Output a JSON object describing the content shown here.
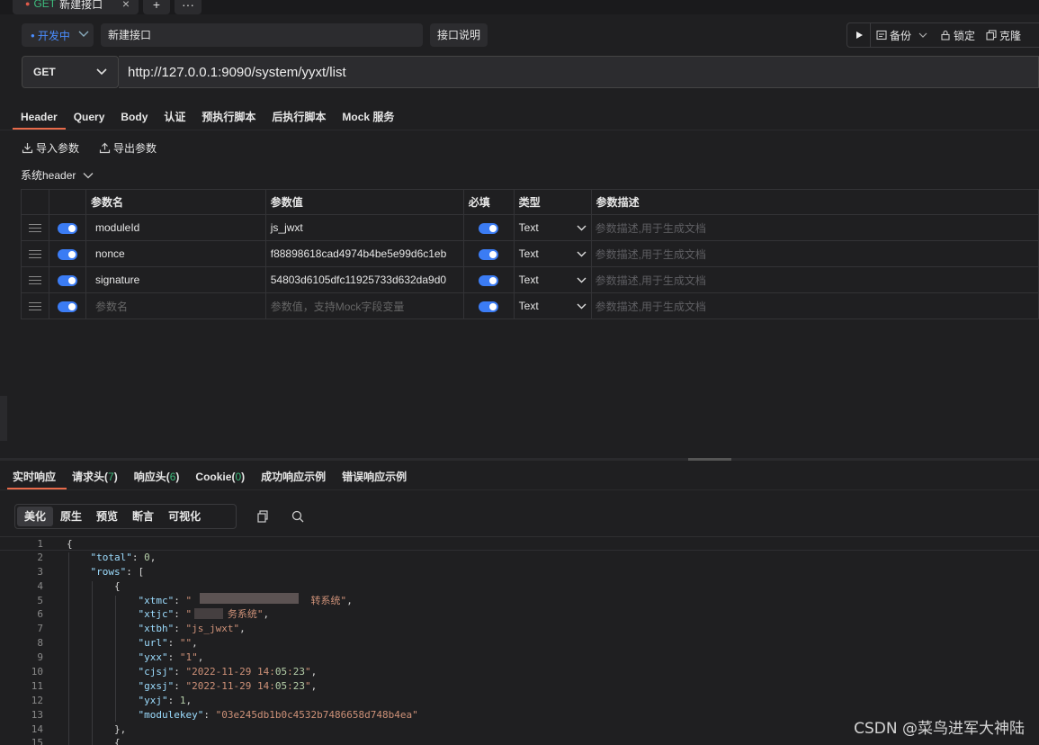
{
  "tab": {
    "method": "GET",
    "title": "新建接口",
    "close": "×",
    "add": "+",
    "more": "···"
  },
  "toolbar": {
    "status": "开发中",
    "name_value": "新建接口",
    "doc_label": "接口说明",
    "backup_label": "备份",
    "lock_label": "锁定",
    "clone_label": "克隆"
  },
  "request": {
    "method": "GET",
    "url": "http://127.0.0.1:9090/system/yyxt/list"
  },
  "req_tabs": [
    "Header",
    "Query",
    "Body",
    "认证",
    "预执行脚本",
    "后执行脚本",
    "Mock 服务"
  ],
  "io": {
    "import_label": "导入参数",
    "export_label": "导出参数"
  },
  "system_header_label": "系统header",
  "params": {
    "headers": [
      "参数名",
      "参数值",
      "必填",
      "类型",
      "参数描述"
    ],
    "rows": [
      {
        "name": "moduleId",
        "value": "js_jwxt",
        "type": "Text",
        "desc": "参数描述,用于生成文档"
      },
      {
        "name": "nonce",
        "value": "f88898618cad4974b4be5e99d6c1eb",
        "type": "Text",
        "desc": "参数描述,用于生成文档"
      },
      {
        "name": "signature",
        "value": "54803d6105dfc11925733d632da9d0",
        "type": "Text",
        "desc": "参数描述,用于生成文档"
      },
      {
        "name": "参数名",
        "value": "参数值，支持Mock字段变量",
        "type": "Text",
        "desc": "参数描述,用于生成文档"
      }
    ]
  },
  "resp_tabs": [
    {
      "label": "实时响应",
      "count": ""
    },
    {
      "label": "请求头",
      "count": "7"
    },
    {
      "label": "响应头",
      "count": "6"
    },
    {
      "label": "Cookie",
      "count": "0"
    },
    {
      "label": "成功响应示例",
      "count": ""
    },
    {
      "label": "错误响应示例",
      "count": ""
    }
  ],
  "format_tabs": [
    "美化",
    "原生",
    "预览",
    "断言",
    "可视化"
  ],
  "code_lines": [
    {
      "no": "1",
      "text": "{"
    },
    {
      "no": "2",
      "text": "    \"total\": 0,"
    },
    {
      "no": "3",
      "text": "    \"rows\": ["
    },
    {
      "no": "4",
      "text": "        {"
    },
    {
      "no": "5",
      "text": "            \"xtmc\": \"                    转系统\","
    },
    {
      "no": "6",
      "text": "            \"xtjc\": \"      务系统\","
    },
    {
      "no": "7",
      "text": "            \"xtbh\": \"js_jwxt\","
    },
    {
      "no": "8",
      "text": "            \"url\": \"\","
    },
    {
      "no": "9",
      "text": "            \"yxx\": \"1\","
    },
    {
      "no": "10",
      "text": "            \"cjsj\": \"2022-11-29 14:05:23\","
    },
    {
      "no": "11",
      "text": "            \"gxsj\": \"2022-11-29 14:05:23\","
    },
    {
      "no": "12",
      "text": "            \"yxj\": 1,"
    },
    {
      "no": "13",
      "text": "            \"modulekey\": \"03e245db1b0c4532b7486658d748b4ea\""
    },
    {
      "no": "14",
      "text": "        },"
    },
    {
      "no": "15",
      "text": "        {"
    }
  ],
  "watermark": "CSDN @菜鸟进军大神陆",
  "colors": {
    "accent": "#e86a4a",
    "toggle": "#3b7cf4",
    "method_get": "#3dbd7d",
    "status": "#4a8dff"
  }
}
